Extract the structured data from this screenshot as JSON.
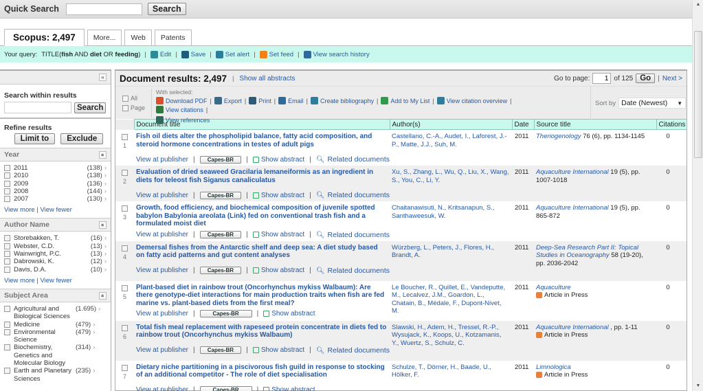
{
  "quick_search": {
    "label": "Quick Search",
    "value": "",
    "button": "Search"
  },
  "tabs": [
    {
      "label": "Scopus: 2,497",
      "active": true
    },
    {
      "label": "More..."
    },
    {
      "label": "Web"
    },
    {
      "label": "Patents"
    }
  ],
  "query": {
    "prefix": "Your query:",
    "text_parts": [
      "TITLE(",
      "fish",
      " AND ",
      "diet",
      " OR ",
      "feeding",
      ")"
    ],
    "actions": [
      {
        "label": "Edit",
        "icon": "edit-icon",
        "color": "#2e8b9a"
      },
      {
        "label": "Save",
        "icon": "save-icon",
        "color": "#1f5b7a"
      },
      {
        "label": "Set alert",
        "icon": "alert-icon",
        "color": "#2e7d9a"
      },
      {
        "label": "Set feed",
        "icon": "rss-icon",
        "color": "#f0821e"
      },
      {
        "label": "View search history",
        "icon": "history-icon",
        "color": "#2e6a9a"
      }
    ]
  },
  "sidebar": {
    "collapse": "«",
    "search_within": {
      "title": "Search within results",
      "value": "",
      "button": "Search"
    },
    "refine": {
      "title": "Refine results",
      "limit_to": "Limit to",
      "exclude": "Exclude"
    },
    "facets": [
      {
        "title": "Year",
        "items": [
          {
            "name": "2011",
            "count": "(138)"
          },
          {
            "name": "2010",
            "count": "(138)"
          },
          {
            "name": "2009",
            "count": "(136)"
          },
          {
            "name": "2008",
            "count": "(144)"
          },
          {
            "name": "2007",
            "count": "(130)"
          }
        ],
        "view_more": "View more",
        "view_fewer": "View fewer"
      },
      {
        "title": "Author Name",
        "items": [
          {
            "name": "Storebakken, T.",
            "count": "(16)"
          },
          {
            "name": "Webster, C.D.",
            "count": "(13)"
          },
          {
            "name": "Wainwright, P.C.",
            "count": "(13)"
          },
          {
            "name": "Dabrowski, K.",
            "count": "(12)"
          },
          {
            "name": "Davis, D.A.",
            "count": "(10)"
          }
        ],
        "view_more": "View more",
        "view_fewer": "View fewer"
      },
      {
        "title": "Subject Area",
        "items": [
          {
            "name": "Agricultural and Biological Sciences",
            "count": "(1.695)"
          },
          {
            "name": "Medicine",
            "count": "(479)"
          },
          {
            "name": "Environmental Science",
            "count": "(479)"
          },
          {
            "name": "Biochemistry, Genetics and Molecular Biology",
            "count": "(314)"
          },
          {
            "name": "Earth and Planetary Sciences",
            "count": "(235)"
          }
        ]
      }
    ]
  },
  "results": {
    "title": "Document results: 2,497",
    "show_all_abstracts": "Show all abstracts",
    "pager": {
      "label": "Go to page:",
      "page": "1",
      "of": "of 125",
      "go": "Go",
      "next": "Next >"
    },
    "select": {
      "all": "All",
      "page": "Page",
      "with_selected": "With selected:"
    },
    "actions": [
      {
        "label": "Download PDF",
        "icon": "pdf-icon",
        "color": "#d9502a"
      },
      {
        "label": "Export",
        "icon": "export-icon",
        "color": "#3a6a8a"
      },
      {
        "label": "Print",
        "icon": "print-icon",
        "color": "#2e5a7a"
      },
      {
        "label": "Email",
        "icon": "email-icon",
        "color": "#2e6a9a"
      },
      {
        "label": "Create bibliography",
        "icon": "bibliography-icon",
        "color": "#2e7d9a"
      },
      {
        "label": "Add to My List",
        "icon": "add-icon",
        "color": "#2f9a4a"
      },
      {
        "label": "View citation overview",
        "icon": "chart-icon",
        "color": "#2e7d9a"
      },
      {
        "label": "View citations",
        "icon": "quote-icon",
        "color": "#2f7a3a"
      },
      {
        "label": "View references",
        "icon": "references-icon",
        "color": "#2e6a5a"
      }
    ],
    "sort": {
      "label": "Sort by",
      "value": "Date (Newest)"
    },
    "columns": [
      "Document title",
      "Author(s)",
      "Date",
      "Source title",
      "Citations"
    ],
    "row_actions": {
      "publisher": "View at publisher",
      "capes": "Capes-BR",
      "abstract": "Show abstract",
      "related": "Related documents"
    },
    "rows": [
      {
        "num": "1",
        "title": "Fish oil diets alter the phospholipid balance, fatty acid composition, and steroid hormone concentrations in testes of adult pigs",
        "authors": "Castellano, C.-A., Audet, I., Laforest, J.-P., Matte, J.J., Suh, M.",
        "date": "2011",
        "source": "Theriogenology",
        "source_rest": " 76 (6), pp. 1134-1145",
        "in_press": "",
        "citations": "0",
        "related": true
      },
      {
        "num": "2",
        "title": "Evaluation of dried seaweed Gracilaria lemaneiformis as an ingredient in diets for teleost fish Siganus canaliculatus",
        "authors": "Xu, S., Zhang, L., Wu, Q., Liu, X., Wang, S., You, C., Li, Y.",
        "date": "2011",
        "source": "Aquaculture International",
        "source_rest": " 19 (5), pp. 1007-1018",
        "in_press": "",
        "citations": "0",
        "related": true
      },
      {
        "num": "3",
        "title": "Growth, food efficiency, and biochemical composition of juvenile spotted babylon Babylonia areolata (Link) fed on conventional trash fish and a formulated moist diet",
        "authors": "Chaitanawisuti, N., Kritsanapun, S., Santhaweesuk, W.",
        "date": "2011",
        "source": "Aquaculture International",
        "source_rest": " 19 (5), pp. 865-872",
        "in_press": "",
        "citations": "0",
        "related": true
      },
      {
        "num": "4",
        "title": "Demersal fishes from the Antarctic shelf and deep sea: A diet study based on fatty acid patterns and gut content analyses",
        "authors": "Würzberg, L., Peters, J., Flores, H., Brandt, A.",
        "date": "2011",
        "source": "Deep-Sea Research Part II: Topical Studies in Oceanography",
        "source_rest": " 58 (19-20), pp. 2036-2042",
        "in_press": "",
        "citations": "0",
        "related": true
      },
      {
        "num": "5",
        "title": "Plant-based diet in rainbow trout (Oncorhynchus mykiss Walbaum): Are there genotype-diet interactions for main production traits when fish are fed marine vs. plant-based diets from the first meal?",
        "authors": "Le Boucher, R., Quillet, E., Vandeputte, M., Lecalvez, J.M., Goardon, L., Chatain, B., Médale, F., Dupont-Nivet, M.",
        "date": "2011",
        "source": "Aquaculture",
        "source_rest": "",
        "in_press": "Article in Press",
        "citations": "0",
        "related": false
      },
      {
        "num": "6",
        "title": "Total fish meal replacement with rapeseed protein concentrate in diets fed to rainbow trout (Oncorhynchus mykiss Walbaum)",
        "authors": "Slawski, H., Adem, H., Tressel, R.-P., Wysujack, K., Koops, U., Kotzamanis, Y., Wuertz, S., Schulz, C.",
        "date": "2011",
        "source": "Aquaculture International",
        "source_rest": " , pp. 1-11",
        "in_press": "Article in Press",
        "citations": "0",
        "related": true
      },
      {
        "num": "7",
        "title": "Dietary niche partitioning in a piscivorous fish guild in response to stocking of an additional competitor - The role of diet specialisation",
        "authors": "Schulze, T., Dörner, H., Baade, U., Hölker, F.",
        "date": "2011",
        "source": "Limnologica",
        "source_rest": "",
        "in_press": "Article in Press",
        "citations": "0",
        "related": false
      }
    ]
  },
  "colors": {
    "accent_bg": "#c9f8ed",
    "link": "#2659a3",
    "panel_bg": "#ececec"
  }
}
